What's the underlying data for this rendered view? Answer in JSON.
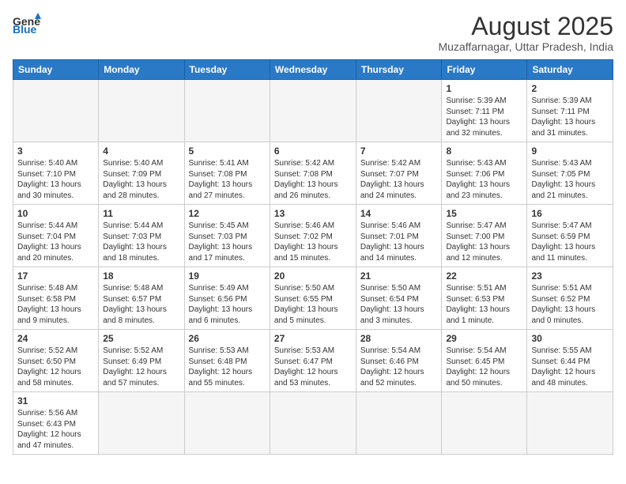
{
  "header": {
    "logo_general": "General",
    "logo_blue": "Blue",
    "title": "August 2025",
    "subtitle": "Muzaffarnagar, Uttar Pradesh, India"
  },
  "weekdays": [
    "Sunday",
    "Monday",
    "Tuesday",
    "Wednesday",
    "Thursday",
    "Friday",
    "Saturday"
  ],
  "days": {
    "1": {
      "sunrise": "5:39 AM",
      "sunset": "7:11 PM",
      "daylight": "13 hours and 32 minutes."
    },
    "2": {
      "sunrise": "5:39 AM",
      "sunset": "7:11 PM",
      "daylight": "13 hours and 31 minutes."
    },
    "3": {
      "sunrise": "5:40 AM",
      "sunset": "7:10 PM",
      "daylight": "13 hours and 30 minutes."
    },
    "4": {
      "sunrise": "5:40 AM",
      "sunset": "7:09 PM",
      "daylight": "13 hours and 28 minutes."
    },
    "5": {
      "sunrise": "5:41 AM",
      "sunset": "7:08 PM",
      "daylight": "13 hours and 27 minutes."
    },
    "6": {
      "sunrise": "5:42 AM",
      "sunset": "7:08 PM",
      "daylight": "13 hours and 26 minutes."
    },
    "7": {
      "sunrise": "5:42 AM",
      "sunset": "7:07 PM",
      "daylight": "13 hours and 24 minutes."
    },
    "8": {
      "sunrise": "5:43 AM",
      "sunset": "7:06 PM",
      "daylight": "13 hours and 23 minutes."
    },
    "9": {
      "sunrise": "5:43 AM",
      "sunset": "7:05 PM",
      "daylight": "13 hours and 21 minutes."
    },
    "10": {
      "sunrise": "5:44 AM",
      "sunset": "7:04 PM",
      "daylight": "13 hours and 20 minutes."
    },
    "11": {
      "sunrise": "5:44 AM",
      "sunset": "7:03 PM",
      "daylight": "13 hours and 18 minutes."
    },
    "12": {
      "sunrise": "5:45 AM",
      "sunset": "7:03 PM",
      "daylight": "13 hours and 17 minutes."
    },
    "13": {
      "sunrise": "5:46 AM",
      "sunset": "7:02 PM",
      "daylight": "13 hours and 15 minutes."
    },
    "14": {
      "sunrise": "5:46 AM",
      "sunset": "7:01 PM",
      "daylight": "13 hours and 14 minutes."
    },
    "15": {
      "sunrise": "5:47 AM",
      "sunset": "7:00 PM",
      "daylight": "13 hours and 12 minutes."
    },
    "16": {
      "sunrise": "5:47 AM",
      "sunset": "6:59 PM",
      "daylight": "13 hours and 11 minutes."
    },
    "17": {
      "sunrise": "5:48 AM",
      "sunset": "6:58 PM",
      "daylight": "13 hours and 9 minutes."
    },
    "18": {
      "sunrise": "5:48 AM",
      "sunset": "6:57 PM",
      "daylight": "13 hours and 8 minutes."
    },
    "19": {
      "sunrise": "5:49 AM",
      "sunset": "6:56 PM",
      "daylight": "13 hours and 6 minutes."
    },
    "20": {
      "sunrise": "5:50 AM",
      "sunset": "6:55 PM",
      "daylight": "13 hours and 5 minutes."
    },
    "21": {
      "sunrise": "5:50 AM",
      "sunset": "6:54 PM",
      "daylight": "13 hours and 3 minutes."
    },
    "22": {
      "sunrise": "5:51 AM",
      "sunset": "6:53 PM",
      "daylight": "13 hours and 1 minute."
    },
    "23": {
      "sunrise": "5:51 AM",
      "sunset": "6:52 PM",
      "daylight": "13 hours and 0 minutes."
    },
    "24": {
      "sunrise": "5:52 AM",
      "sunset": "6:50 PM",
      "daylight": "12 hours and 58 minutes."
    },
    "25": {
      "sunrise": "5:52 AM",
      "sunset": "6:49 PM",
      "daylight": "12 hours and 57 minutes."
    },
    "26": {
      "sunrise": "5:53 AM",
      "sunset": "6:48 PM",
      "daylight": "12 hours and 55 minutes."
    },
    "27": {
      "sunrise": "5:53 AM",
      "sunset": "6:47 PM",
      "daylight": "12 hours and 53 minutes."
    },
    "28": {
      "sunrise": "5:54 AM",
      "sunset": "6:46 PM",
      "daylight": "12 hours and 52 minutes."
    },
    "29": {
      "sunrise": "5:54 AM",
      "sunset": "6:45 PM",
      "daylight": "12 hours and 50 minutes."
    },
    "30": {
      "sunrise": "5:55 AM",
      "sunset": "6:44 PM",
      "daylight": "12 hours and 48 minutes."
    },
    "31": {
      "sunrise": "5:56 AM",
      "sunset": "6:43 PM",
      "daylight": "12 hours and 47 minutes."
    }
  }
}
